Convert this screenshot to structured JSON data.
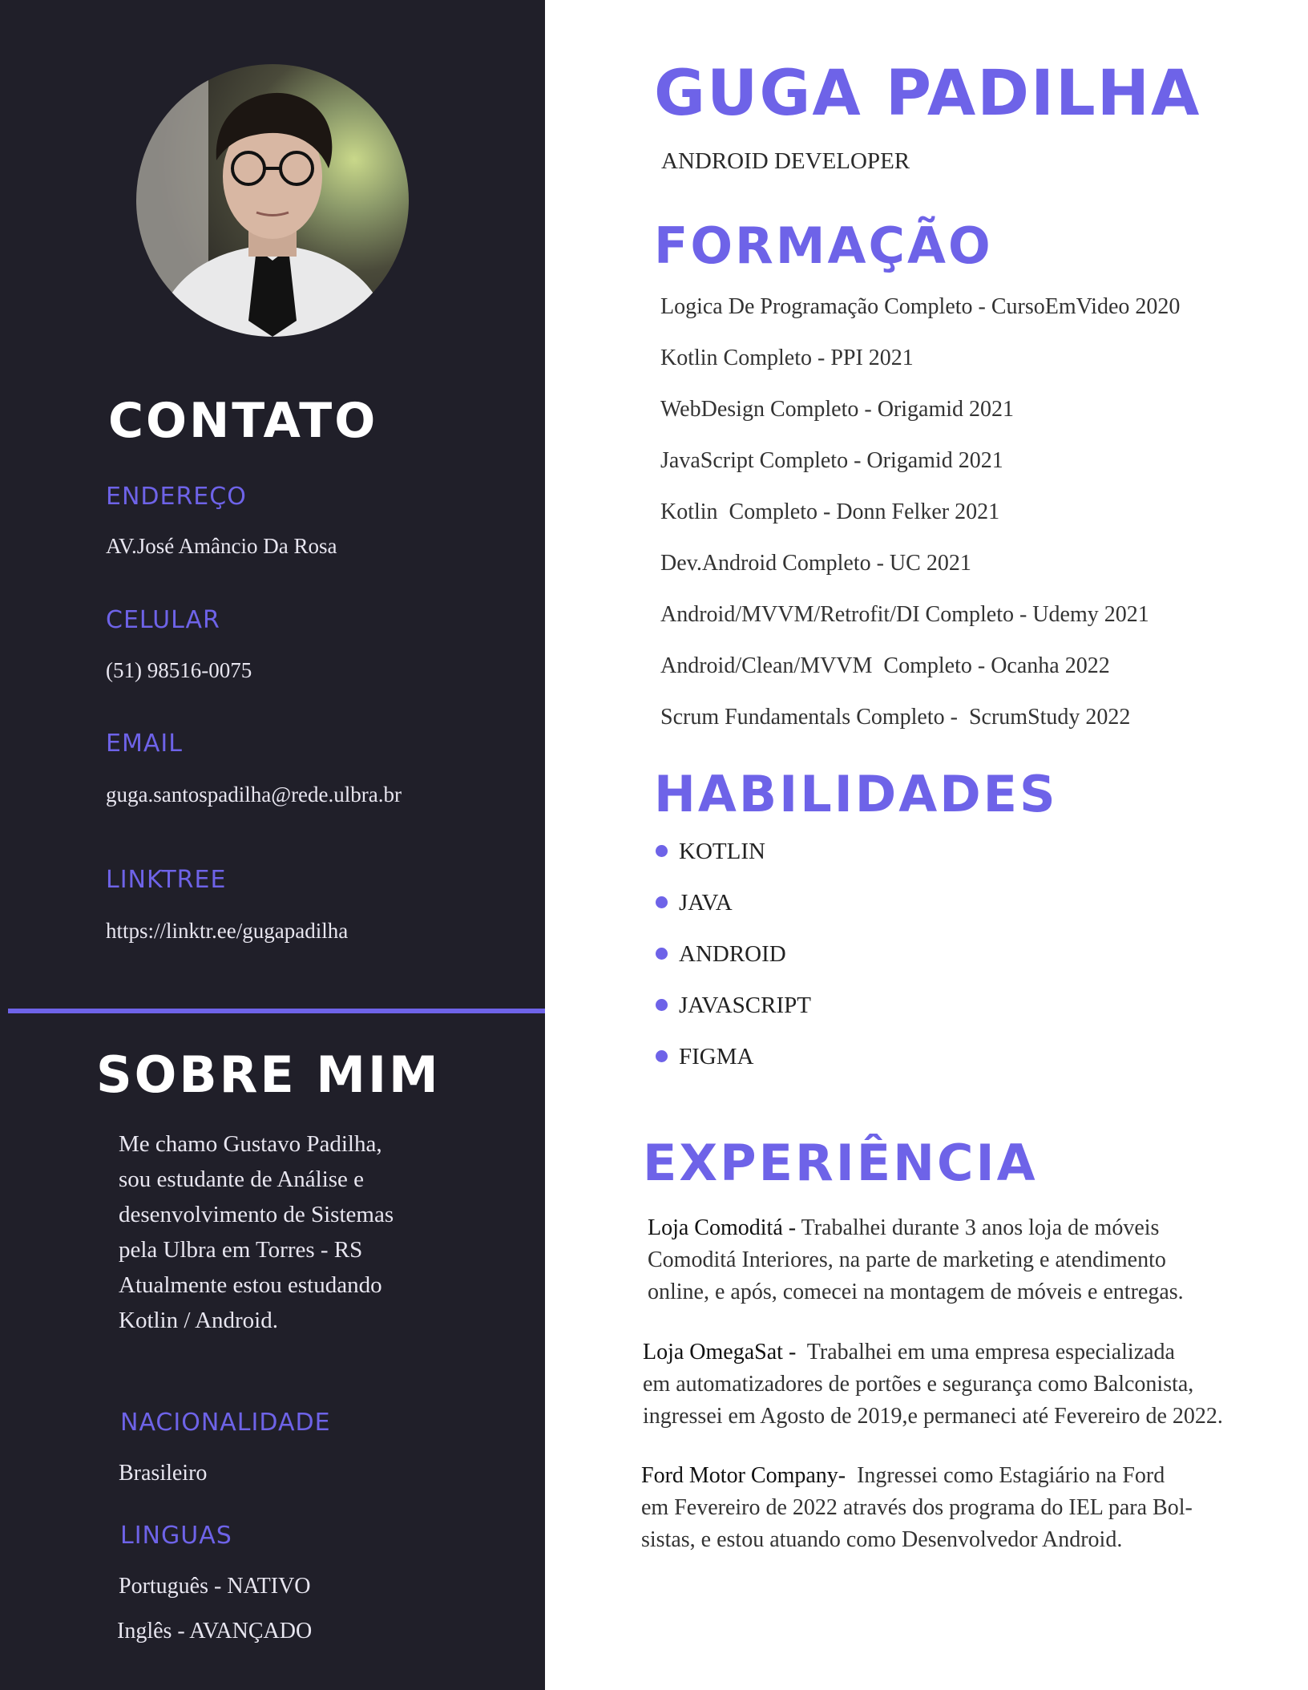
{
  "colors": {
    "sidebar_bg": "#201f29",
    "accent": "#6e63e8",
    "page_bg": "#ffffff"
  },
  "header": {
    "name": "GUGA PADILHA",
    "role": "ANDROID DEVELOPER"
  },
  "contact": {
    "heading": "CONTATO",
    "address_label": "ENDEREÇO",
    "address": "AV.José Amâncio Da Rosa",
    "phone_label": "CELULAR",
    "phone": "(51) 98516-0075",
    "email_label": "EMAIL",
    "email": "guga.santospadilha@rede.ulbra.br",
    "linktree_label": "LINKTREE",
    "linktree": "https://linktr.ee/gugapadilha"
  },
  "about": {
    "heading": "SOBRE MIM",
    "lines": [
      "Me chamo Gustavo Padilha,",
      "sou estudante de Análise e",
      "desenvolvimento de Sistemas",
      "pela Ulbra em Torres - RS",
      "Atualmente estou estudando",
      "Kotlin / Android."
    ],
    "nationality_label": "NACIONALIDADE",
    "nationality": "Brasileiro",
    "languages_label": "LINGUAS",
    "languages": [
      "Português - NATIVO",
      "Inglês - AVANÇADO"
    ]
  },
  "education": {
    "heading": "FORMAÇÃO",
    "items": [
      "Logica De Programação Completo - CursoEmVideo 2020",
      "Kotlin Completo - PPI 2021",
      "WebDesign Completo - Origamid 2021",
      "JavaScript Completo - Origamid 2021",
      "Kotlin  Completo - Donn Felker 2021",
      "Dev.Android Completo - UC 2021",
      "Android/MVVM/Retrofit/DI Completo - Udemy 2021",
      "Android/Clean/MVVM  Completo - Ocanha 2022",
      "Scrum Fundamentals Completo -  ScrumStudy 2022"
    ]
  },
  "skills": {
    "heading": "HABILIDADES",
    "items": [
      "KOTLIN",
      "JAVA",
      "ANDROID",
      "JAVASCRIPT",
      "FIGMA"
    ]
  },
  "experience": {
    "heading": "EXPERIÊNCIA",
    "items": [
      {
        "company": "Loja Comoditá - ",
        "line1": "Trabalhei durante 3 anos loja de móveis",
        "line2": "Comoditá Interiores, na parte de marketing e atendimento",
        "line3": "online, e após, comecei na montagem de móveis e entregas."
      },
      {
        "company": "Loja OmegaSat -  ",
        "line1": "Trabalhei em uma empresa especializada",
        "line2": "em automatizadores de portões e segurança como Balconista,",
        "line3": "ingressei em Agosto de 2019,e permaneci até Fevereiro de 2022."
      },
      {
        "company": "Ford Motor Company-  ",
        "line1": "Ingressei como Estagiário na Ford",
        "line2": "em Fevereiro de 2022 através dos programa do IEL para Bol-",
        "line3": "sistas, e estou atuando como Desenvolvedor Android."
      }
    ]
  }
}
